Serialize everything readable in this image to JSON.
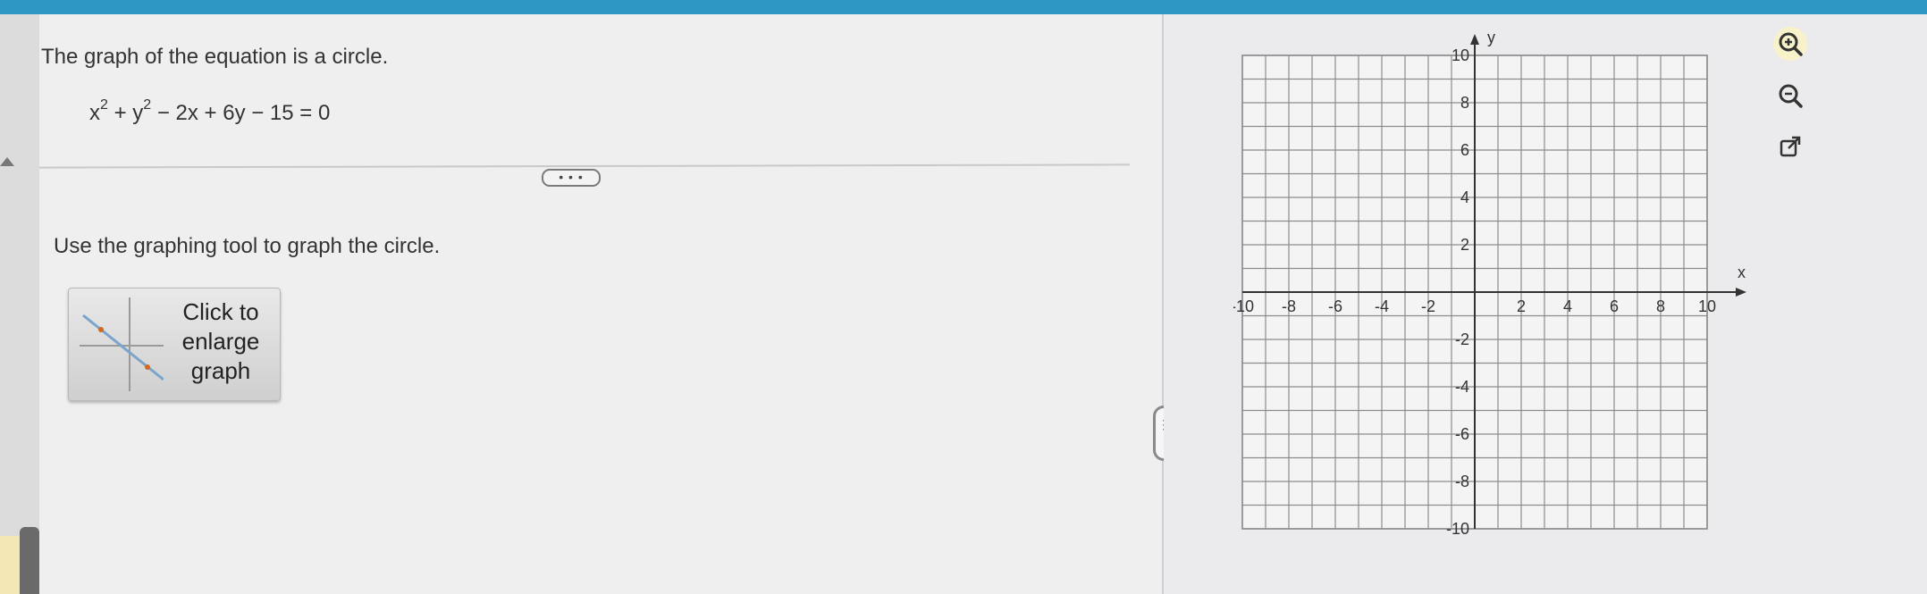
{
  "question": {
    "prompt": "The graph of the equation is a circle.",
    "equation": {
      "part1": "x",
      "exp1": "2",
      "part2": " + y",
      "exp2": "2",
      "part3": " − 2x + 6y − 15 = 0"
    },
    "more_label": "• • •",
    "instruction": "Use the graphing tool to graph the circle."
  },
  "enlarge_button": {
    "line1": "Click to",
    "line2": "enlarge",
    "line3": "graph"
  },
  "graph": {
    "x_axis_label": "x",
    "y_axis_label": "y",
    "x_ticks": [
      "-10",
      "-8",
      "-6",
      "-4",
      "-2",
      "2",
      "4",
      "6",
      "8",
      "10"
    ],
    "y_ticks": [
      "10",
      "8",
      "6",
      "4",
      "2",
      "-2",
      "-4",
      "-6",
      "-8",
      "-10"
    ],
    "x_range": [
      -10,
      10
    ],
    "y_range": [
      -10,
      10
    ],
    "grid_step": 1
  },
  "splitter_label": "⋮",
  "tools": [
    "zoom-in-icon",
    "zoom-out-icon",
    "open-external-icon"
  ],
  "colors": {
    "accent": "#2f97c4",
    "active_tool": "#f7f2c9"
  }
}
